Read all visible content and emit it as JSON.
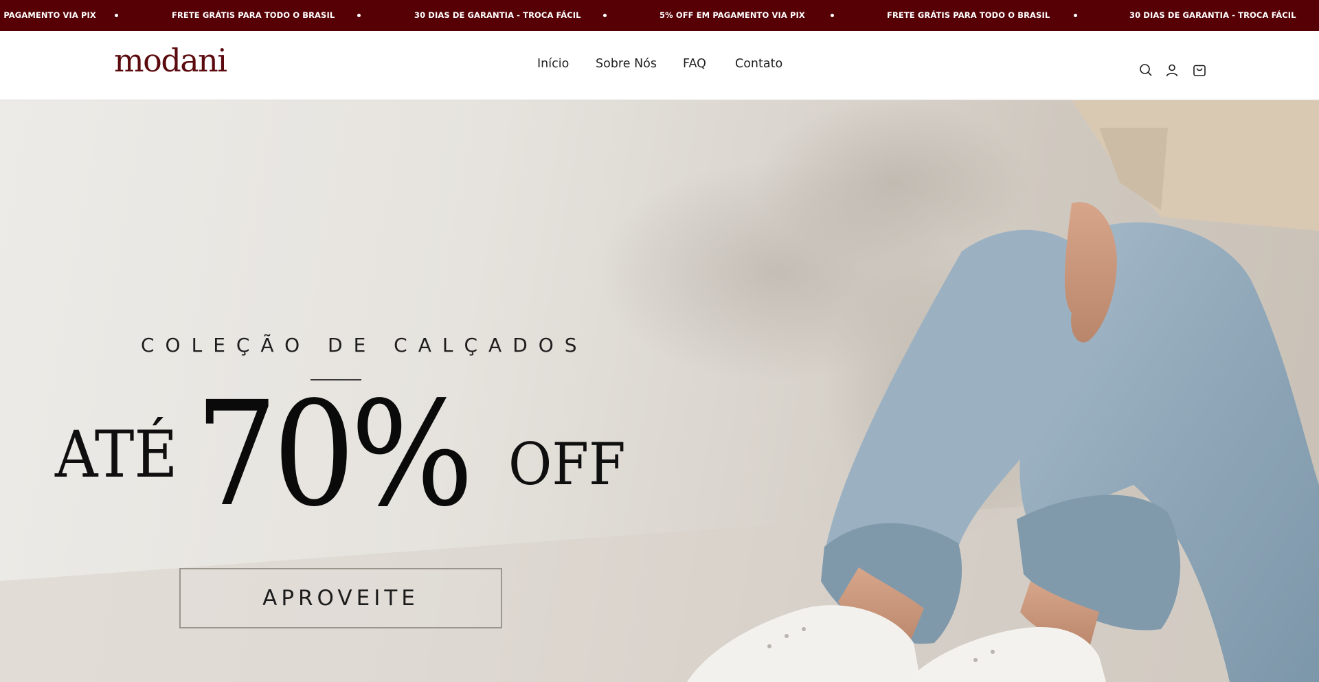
{
  "announcement": {
    "items": [
      "5% OFF EM PAGAMENTO VIA PIX",
      "FRETE GRÁTIS PARA TODO O BRASIL",
      "30 DIAS DE GARANTIA - TROCA FÁCIL",
      "5% OFF EM PAGAMENTO VIA PIX",
      "FRETE GRÁTIS PARA TODO O BRASIL",
      "30 DIAS DE GARANTIA - TROCA FÁCIL"
    ],
    "background": "#560006"
  },
  "header": {
    "logo": "modani",
    "nav": [
      "Início",
      "Sobre Nós",
      "FAQ",
      "Contato"
    ],
    "icons": [
      "search-icon",
      "account-icon",
      "cart-icon"
    ]
  },
  "hero": {
    "eyebrow": "COLEÇÃO DE CALÇADOS",
    "prefix": "ATÉ",
    "discount": "70%",
    "suffix": "OFF",
    "cta_label": "APROVEITE"
  },
  "colors": {
    "brand": "#5b0a0e",
    "text": "#1f1f1f"
  }
}
